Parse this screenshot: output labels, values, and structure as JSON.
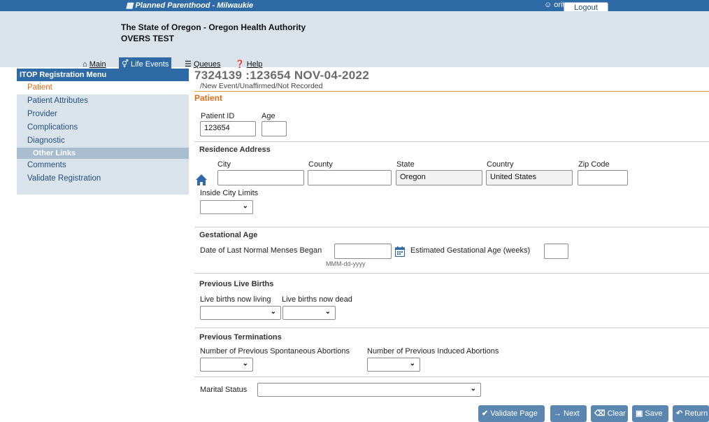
{
  "topbar": {
    "org": "Planned Parenthood - Milwaukie",
    "user": "oritop",
    "logout_label": "Logout"
  },
  "header": {
    "state_title": "The State of Oregon - Oregon Health Authority",
    "env_title": "OVERS TEST"
  },
  "nav": {
    "main": "Main",
    "life_events": "Life Events",
    "queues": "Queues",
    "help": "Help"
  },
  "sidebar": {
    "title": "ITOP Registration Menu",
    "items": [
      "Patient",
      "Patient Attributes",
      "Provider",
      "Complications",
      "Diagnostic"
    ],
    "other_links": "Other Links",
    "links": [
      "Comments",
      "Validate Registration"
    ]
  },
  "record": {
    "title": "7324139  :123654 NOV-04-2022",
    "subtitle": "/New Event/Unaffirmed/Not Recorded"
  },
  "section": "Patient",
  "patient": {
    "id_label": "Patient ID",
    "id_value": "123654",
    "age_label": "Age",
    "age_value": ""
  },
  "residence": {
    "heading": "Residence Address",
    "city_label": "City",
    "county_label": "County",
    "state_label": "State",
    "state_value": "Oregon",
    "country_label": "Country",
    "country_value": "United States",
    "zip_label": "Zip Code",
    "inside_city_label": "Inside City Limits"
  },
  "gestational": {
    "heading": "Gestational Age",
    "lmp_label": "Date of Last Normal Menses Began",
    "date_hint": "MMM-dd-yyyy",
    "est_label": "Estimated Gestational Age (weeks)"
  },
  "live_births": {
    "heading": "Previous Live Births",
    "living_label": "Live births now living",
    "dead_label": "Live births now dead"
  },
  "terminations": {
    "heading": "Previous Terminations",
    "spont_label": "Number of Previous Spontaneous Abortions",
    "induced_label": "Number of Previous Induced Abortions"
  },
  "marital": {
    "label": "Marital Status"
  },
  "buttons": {
    "validate": "Validate Page",
    "next": "Next",
    "clear": "Clear",
    "save": "Save",
    "return": "Return"
  }
}
